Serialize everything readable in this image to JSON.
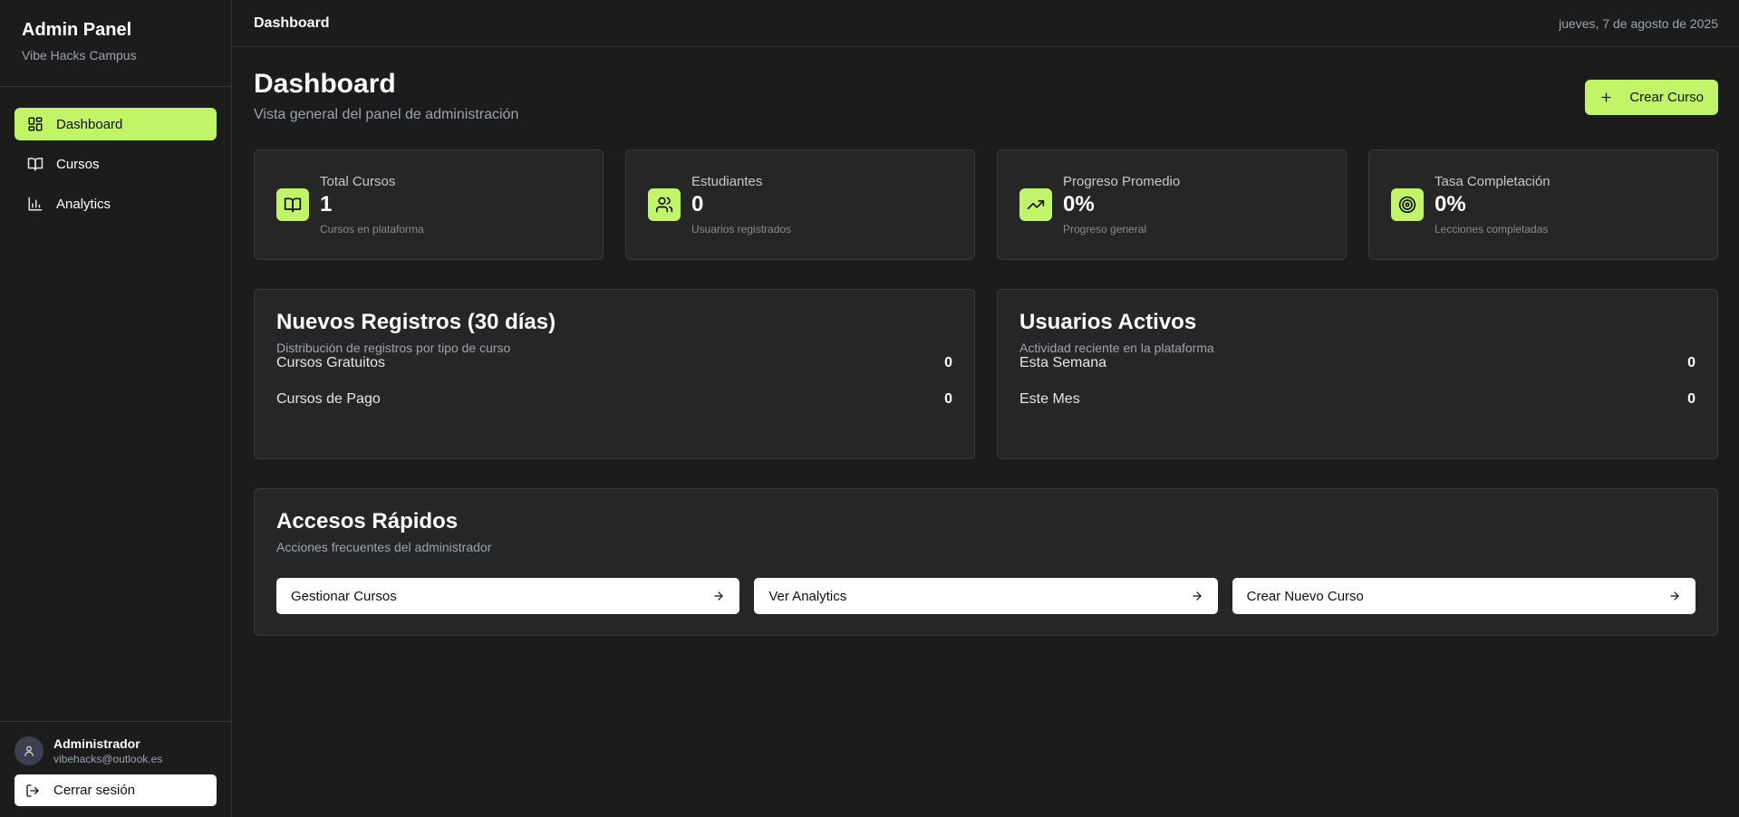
{
  "brand": {
    "title": "Admin Panel",
    "subtitle": "Vibe Hacks Campus"
  },
  "nav": [
    {
      "label": "Dashboard",
      "icon": "layout-dashboard-icon",
      "active": true
    },
    {
      "label": "Cursos",
      "icon": "book-open-icon",
      "active": false
    },
    {
      "label": "Analytics",
      "icon": "bar-chart-icon",
      "active": false
    }
  ],
  "user": {
    "name": "Administrador",
    "email": "vibehacks@outlook.es",
    "logout_label": "Cerrar sesión"
  },
  "topbar": {
    "title": "Dashboard",
    "date": "jueves, 7 de agosto de 2025"
  },
  "page": {
    "title": "Dashboard",
    "subtitle": "Vista general del panel de administración",
    "create_label": "Crear Curso"
  },
  "stats": [
    {
      "label": "Total Cursos",
      "value": "1",
      "desc": "Cursos en plataforma",
      "icon": "book-open-icon"
    },
    {
      "label": "Estudiantes",
      "value": "0",
      "desc": "Usuarios registrados",
      "icon": "users-icon"
    },
    {
      "label": "Progreso Promedio",
      "value": "0%",
      "desc": "Progreso general",
      "icon": "trending-up-icon"
    },
    {
      "label": "Tasa Completación",
      "value": "0%",
      "desc": "Lecciones completadas",
      "icon": "target-icon"
    }
  ],
  "registros": {
    "title": "Nuevos Registros (30 días)",
    "subtitle": "Distribución de registros por tipo de curso",
    "rows": [
      {
        "label": "Cursos Gratuitos",
        "value": "0"
      },
      {
        "label": "Cursos de Pago",
        "value": "0"
      }
    ]
  },
  "activos": {
    "title": "Usuarios Activos",
    "subtitle": "Actividad reciente en la plataforma",
    "rows": [
      {
        "label": "Esta Semana",
        "value": "0"
      },
      {
        "label": "Este Mes",
        "value": "0"
      }
    ]
  },
  "quick": {
    "title": "Accesos Rápidos",
    "subtitle": "Acciones frecuentes del administrador",
    "actions": [
      {
        "label": "Gestionar Cursos"
      },
      {
        "label": "Ver Analytics"
      },
      {
        "label": "Crear Nuevo Curso"
      }
    ]
  },
  "colors": {
    "accent": "#c2f46a",
    "background": "#1c1c1c",
    "card": "#262626"
  }
}
